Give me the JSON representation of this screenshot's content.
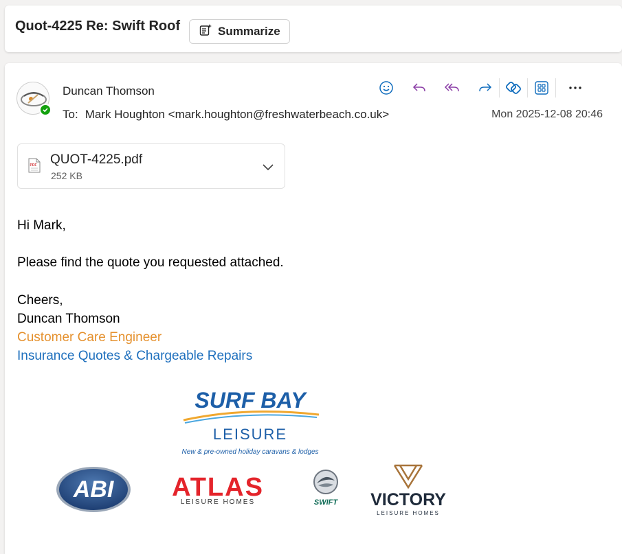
{
  "subject": {
    "title": "Quot-4225 Re: Swift Roof",
    "summarize_label": "Summarize"
  },
  "message": {
    "sender": "Duncan Thomson",
    "to_label": "To:",
    "to_value": "Mark Houghton <mark.houghton@freshwaterbeach.co.uk>",
    "date": "Mon 2025-12-08 20:46",
    "actions": [
      "emoji-icon",
      "reply-icon",
      "reply-all-icon",
      "forward-icon",
      "loop-icon",
      "apps-icon",
      "more-icon"
    ]
  },
  "attachment": {
    "name": "QUOT-4225.pdf",
    "size": "252 KB",
    "icon_text": "PDF"
  },
  "body": {
    "greeting": "Hi Mark,",
    "line1": "Please find the quote you requested attached.",
    "signoff": "Cheers,",
    "name": "Duncan Thomson",
    "role": "Customer Care Engineer",
    "dept": "Insurance Quotes & Chargeable Repairs"
  },
  "logos": {
    "surfbay_title": "SURF BAY",
    "surfbay_sub": "LEISURE",
    "surfbay_tag": "New & pre-owned holiday caravans & lodges",
    "abi": "ABI",
    "atlas": "ATLAS",
    "atlas_sub": "LEISURE HOMES",
    "swift": "SWIFT",
    "victory": "VICTORY",
    "victory_sub": "LEISURE HOMES"
  },
  "colors": {
    "orange": "#e5912e",
    "blue": "#1d6fbd",
    "accent": "#0f6cbd",
    "purple": "#8a3ca6",
    "presence": "#13a10e"
  }
}
